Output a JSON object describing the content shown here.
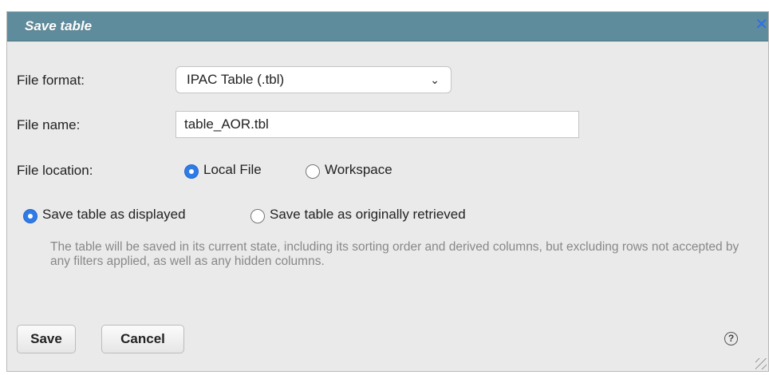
{
  "dialog": {
    "title": "Save table",
    "close_glyph": "✕"
  },
  "form": {
    "file_format_label": "File format:",
    "file_format_value": "IPAC Table (.tbl)",
    "file_name_label": "File name:",
    "file_name_value": "table_AOR.tbl",
    "file_location_label": "File location:",
    "location_options": [
      {
        "label": "Local File",
        "selected": true
      },
      {
        "label": "Workspace",
        "selected": false
      }
    ],
    "save_mode_options": [
      {
        "label": "Save table as displayed",
        "selected": true
      },
      {
        "label": "Save table as originally retrieved",
        "selected": false
      }
    ],
    "help_text": "The table will be saved in its current state, including its sorting order and derived columns, but excluding rows not accepted by any filters applied, as well as any hidden columns."
  },
  "buttons": {
    "save_label": "Save",
    "cancel_label": "Cancel",
    "help_glyph": "?"
  },
  "icons": {
    "dropdown": "chevron-down-icon",
    "close": "close-icon",
    "help": "help-icon"
  },
  "colors": {
    "titlebar": "#5f8c9c",
    "radio_selected": "#2f7be8",
    "close_icon": "#2f6fe0"
  }
}
